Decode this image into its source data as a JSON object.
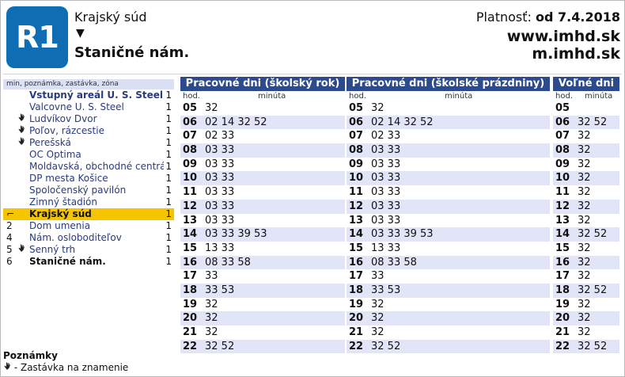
{
  "header": {
    "line": "R1",
    "from": "Krajský súd",
    "arrow": "▼",
    "to": "Staničné nám.",
    "valid_label": "Platnosť:",
    "valid_value": "od 7.4.2018",
    "web": "www.imhd.sk",
    "mweb": "m.imhd.sk"
  },
  "stops_header": "min, poznámka, zastávka, zóna",
  "stops": [
    {
      "min": "",
      "icon": "",
      "name": "Vstupný areál U. S. Steel",
      "zone": "1",
      "style": "bold"
    },
    {
      "min": "",
      "icon": "",
      "name": "Valcovne U. S. Steel",
      "zone": "1",
      "style": ""
    },
    {
      "min": "",
      "icon": "hand",
      "name": "Ludvíkov Dvor",
      "zone": "1",
      "style": ""
    },
    {
      "min": "",
      "icon": "hand",
      "name": "Poľov, rázcestie",
      "zone": "1",
      "style": ""
    },
    {
      "min": "",
      "icon": "hand",
      "name": "Perešská",
      "zone": "1",
      "style": ""
    },
    {
      "min": "",
      "icon": "",
      "name": "OC Optima",
      "zone": "1",
      "style": ""
    },
    {
      "min": "",
      "icon": "",
      "name": "Moldavská, obchodné centrá",
      "zone": "1",
      "style": ""
    },
    {
      "min": "",
      "icon": "",
      "name": "DP mesta Košice",
      "zone": "1",
      "style": ""
    },
    {
      "min": "",
      "icon": "",
      "name": "Spoločenský pavilón",
      "zone": "1",
      "style": ""
    },
    {
      "min": "",
      "icon": "",
      "name": "Zimný štadión",
      "zone": "1",
      "style": ""
    },
    {
      "min": "⌐",
      "icon": "",
      "name": "Krajský súd",
      "zone": "1",
      "style": "current"
    },
    {
      "min": "2",
      "icon": "",
      "name": "Dom umenia",
      "zone": "1",
      "style": ""
    },
    {
      "min": "4",
      "icon": "",
      "name": "Nám. osloboditeľov",
      "zone": "1",
      "style": ""
    },
    {
      "min": "5",
      "icon": "hand",
      "name": "Senný trh",
      "zone": "1",
      "style": ""
    },
    {
      "min": "6",
      "icon": "",
      "name": "Staničné nám.",
      "zone": "1",
      "style": "last"
    }
  ],
  "tables": [
    {
      "title": "Pracovné dni (školský rok)",
      "hod": "hod.",
      "min": "minúta",
      "rows": [
        {
          "h": "05",
          "m": "32"
        },
        {
          "h": "06",
          "m": "02 14 32 52"
        },
        {
          "h": "07",
          "m": "02 33"
        },
        {
          "h": "08",
          "m": "03 33"
        },
        {
          "h": "09",
          "m": "03 33"
        },
        {
          "h": "10",
          "m": "03 33"
        },
        {
          "h": "11",
          "m": "03 33"
        },
        {
          "h": "12",
          "m": "03 33"
        },
        {
          "h": "13",
          "m": "03 33"
        },
        {
          "h": "14",
          "m": "03 33 39 53"
        },
        {
          "h": "15",
          "m": "13 33"
        },
        {
          "h": "16",
          "m": "08 33 58"
        },
        {
          "h": "17",
          "m": "33"
        },
        {
          "h": "18",
          "m": "33 53"
        },
        {
          "h": "19",
          "m": "32"
        },
        {
          "h": "20",
          "m": "32"
        },
        {
          "h": "21",
          "m": "32"
        },
        {
          "h": "22",
          "m": "32 52"
        }
      ]
    },
    {
      "title": "Pracovné dni (školské prázdniny)",
      "hod": "hod.",
      "min": "minúta",
      "rows": [
        {
          "h": "05",
          "m": "32"
        },
        {
          "h": "06",
          "m": "02 14 32 52"
        },
        {
          "h": "07",
          "m": "02 33"
        },
        {
          "h": "08",
          "m": "03 33"
        },
        {
          "h": "09",
          "m": "03 33"
        },
        {
          "h": "10",
          "m": "03 33"
        },
        {
          "h": "11",
          "m": "03 33"
        },
        {
          "h": "12",
          "m": "03 33"
        },
        {
          "h": "13",
          "m": "03 33"
        },
        {
          "h": "14",
          "m": "03 33 39 53"
        },
        {
          "h": "15",
          "m": "13 33"
        },
        {
          "h": "16",
          "m": "08 33 58"
        },
        {
          "h": "17",
          "m": "33"
        },
        {
          "h": "18",
          "m": "33 53"
        },
        {
          "h": "19",
          "m": "32"
        },
        {
          "h": "20",
          "m": "32"
        },
        {
          "h": "21",
          "m": "32"
        },
        {
          "h": "22",
          "m": "32 52"
        }
      ]
    },
    {
      "title": "Voľné dni",
      "hod": "hod.",
      "min": "minúta",
      "rows": [
        {
          "h": "05",
          "m": ""
        },
        {
          "h": "06",
          "m": "32 52"
        },
        {
          "h": "07",
          "m": "32"
        },
        {
          "h": "08",
          "m": "32"
        },
        {
          "h": "09",
          "m": "32"
        },
        {
          "h": "10",
          "m": "32"
        },
        {
          "h": "11",
          "m": "32"
        },
        {
          "h": "12",
          "m": "32"
        },
        {
          "h": "13",
          "m": "32"
        },
        {
          "h": "14",
          "m": "32 52"
        },
        {
          "h": "15",
          "m": "32"
        },
        {
          "h": "16",
          "m": "32"
        },
        {
          "h": "17",
          "m": "32"
        },
        {
          "h": "18",
          "m": "32 52"
        },
        {
          "h": "19",
          "m": "32"
        },
        {
          "h": "20",
          "m": "32"
        },
        {
          "h": "21",
          "m": "32"
        },
        {
          "h": "22",
          "m": "32 52"
        }
      ]
    }
  ],
  "notes": {
    "title": "Poznámky",
    "items": [
      {
        "icon": "hand",
        "text": "- Zastávka na znamenie"
      }
    ]
  }
}
